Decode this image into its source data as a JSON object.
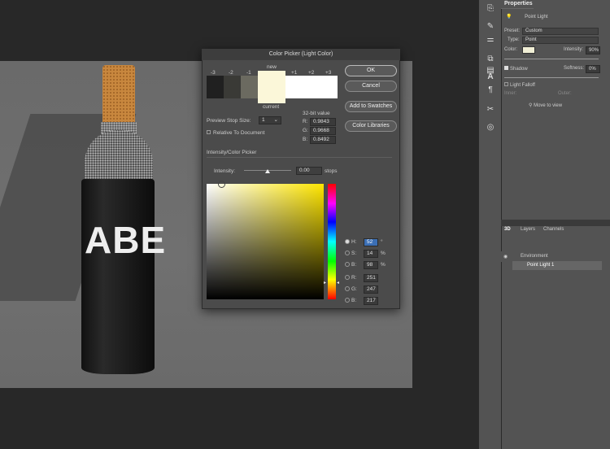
{
  "dialog": {
    "title": "Color Picker (Light Color)",
    "new_label": "new",
    "current_label": "current",
    "stops": [
      "-3",
      "-2",
      "-1",
      "+1",
      "+2",
      "+3"
    ],
    "ok": "OK",
    "cancel": "Cancel",
    "add_swatches": "Add to Swatches",
    "color_libraries": "Color Libraries",
    "preview_stop_size_label": "Preview Stop Size:",
    "preview_stop_size_value": "1",
    "relative_to_document": "Relative To Document",
    "bit_value_label": "32-bit value",
    "r32_label": "R:",
    "r32": "0.9843",
    "g32_label": "G:",
    "g32": "0.9668",
    "b32_label": "B:",
    "b32": "0.8492",
    "section_label": "Intensity/Color Picker",
    "intensity_label": "Intensity:",
    "intensity_value": "0.00",
    "intensity_unit": "stops",
    "h_label": "H:",
    "h": "52",
    "h_unit": "°",
    "s_label": "S:",
    "s": "14",
    "s_unit": "%",
    "bv_label": "B:",
    "bv": "98",
    "bv_unit": "%",
    "r_label": "R:",
    "r": "251",
    "g_label": "G:",
    "g": "247",
    "b_label": "B:",
    "b": "217"
  },
  "properties": {
    "tab": "Properties",
    "header": "Point Light",
    "preset_label": "Preset:",
    "preset": "Custom",
    "type_label": "Type:",
    "type": "Point",
    "color_label": "Color:",
    "intensity_label": "Intensity:",
    "intensity": "90%",
    "shadow_label": "Shadow",
    "softness_label": "Softness:",
    "softness": "0%",
    "light_falloff": "Light Falloff",
    "inner_label": "Inner:",
    "outer_label": "Outer:",
    "move_to_view": "Move to view"
  },
  "layers": {
    "tabs": [
      "3D",
      "Layers",
      "Channels"
    ],
    "items": [
      "Environment",
      "Point Light 1"
    ]
  },
  "canvas": {
    "label_text": "ABE"
  },
  "colors": {
    "light_color": "#fbf7d9",
    "accent": "#3b6fb5"
  }
}
